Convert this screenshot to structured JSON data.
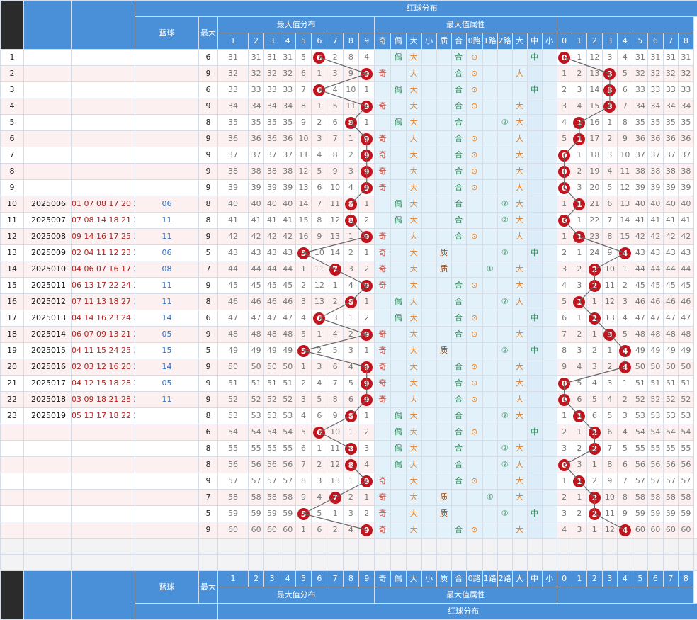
{
  "title": "红球分布",
  "groups": {
    "max_dist": "最大值分布",
    "max_attr": "最大值属性"
  },
  "headers": {
    "blue": "蓝球",
    "sum": "最大",
    "digits": [
      "1",
      "2",
      "3",
      "4",
      "5",
      "6",
      "7",
      "8",
      "9"
    ],
    "attrs": [
      "奇",
      "偶",
      "大",
      "小",
      "质",
      "合",
      "0路",
      "1路",
      "2路",
      "大",
      "中",
      "小"
    ],
    "miss_cols": [
      "0",
      "1",
      "2",
      "3",
      "4",
      "5",
      "6",
      "7",
      "8"
    ]
  },
  "rows": [
    {
      "n": "1",
      "issue": "",
      "reds": "",
      "blue": "",
      "max": "6",
      "miss": [
        "31",
        "31",
        "31",
        "31",
        "5",
        "",
        "2",
        "8",
        "4"
      ],
      "attr": {
        "oe": "偶",
        "bs": "大",
        "pc": "合",
        "road": "0",
        "size": "中"
      },
      "dist": [
        "",
        "1",
        "12",
        "3",
        "4",
        "31",
        "31",
        "31",
        "31"
      ],
      "dpos": 0
    },
    {
      "n": "2",
      "issue": "",
      "reds": "",
      "blue": "",
      "max": "9",
      "miss": [
        "32",
        "32",
        "32",
        "32",
        "6",
        "1",
        "3",
        "9",
        ""
      ],
      "attr": {
        "oe": "奇",
        "bs": "大",
        "pc": "合",
        "road": "0",
        "size": "大"
      },
      "dist": [
        "1",
        "2",
        "13",
        "",
        "5",
        "32",
        "32",
        "32",
        "32"
      ],
      "dpos": 3
    },
    {
      "n": "3",
      "issue": "",
      "reds": "",
      "blue": "",
      "max": "6",
      "miss": [
        "33",
        "33",
        "33",
        "33",
        "7",
        "",
        "4",
        "10",
        "1"
      ],
      "attr": {
        "oe": "偶",
        "bs": "大",
        "pc": "合",
        "road": "0",
        "size": "中"
      },
      "dist": [
        "2",
        "3",
        "14",
        "",
        "6",
        "33",
        "33",
        "33",
        "33"
      ],
      "dpos": 3
    },
    {
      "n": "4",
      "issue": "",
      "reds": "",
      "blue": "",
      "max": "9",
      "miss": [
        "34",
        "34",
        "34",
        "34",
        "8",
        "1",
        "5",
        "11",
        ""
      ],
      "attr": {
        "oe": "奇",
        "bs": "大",
        "pc": "合",
        "road": "0",
        "size": "大"
      },
      "dist": [
        "3",
        "4",
        "15",
        "",
        "7",
        "34",
        "34",
        "34",
        "34"
      ],
      "dpos": 3
    },
    {
      "n": "5",
      "issue": "",
      "reds": "",
      "blue": "",
      "max": "8",
      "miss": [
        "35",
        "35",
        "35",
        "35",
        "9",
        "2",
        "6",
        "",
        "1"
      ],
      "attr": {
        "oe": "偶",
        "bs": "大",
        "pc": "合",
        "road": "2",
        "size": "大"
      },
      "dist": [
        "4",
        "",
        "16",
        "1",
        "8",
        "35",
        "35",
        "35",
        "35"
      ],
      "dpos": 1
    },
    {
      "n": "6",
      "issue": "",
      "reds": "",
      "blue": "",
      "max": "9",
      "miss": [
        "36",
        "36",
        "36",
        "36",
        "10",
        "3",
        "7",
        "1",
        ""
      ],
      "attr": {
        "oe": "奇",
        "bs": "大",
        "pc": "合",
        "road": "0",
        "size": "大"
      },
      "dist": [
        "5",
        "",
        "17",
        "2",
        "9",
        "36",
        "36",
        "36",
        "36"
      ],
      "dpos": 1
    },
    {
      "n": "7",
      "issue": "",
      "reds": "",
      "blue": "",
      "max": "9",
      "miss": [
        "37",
        "37",
        "37",
        "37",
        "11",
        "4",
        "8",
        "2",
        ""
      ],
      "attr": {
        "oe": "奇",
        "bs": "大",
        "pc": "合",
        "road": "0",
        "size": "大"
      },
      "dist": [
        "",
        "1",
        "18",
        "3",
        "10",
        "37",
        "37",
        "37",
        "37"
      ],
      "dpos": 0
    },
    {
      "n": "8",
      "issue": "",
      "reds": "",
      "blue": "",
      "max": "9",
      "miss": [
        "38",
        "38",
        "38",
        "38",
        "12",
        "5",
        "9",
        "3",
        ""
      ],
      "attr": {
        "oe": "奇",
        "bs": "大",
        "pc": "合",
        "road": "0",
        "size": "大"
      },
      "dist": [
        "",
        "2",
        "19",
        "4",
        "11",
        "38",
        "38",
        "38",
        "38"
      ],
      "dpos": 0
    },
    {
      "n": "9",
      "issue": "",
      "reds": "",
      "blue": "",
      "max": "9",
      "miss": [
        "39",
        "39",
        "39",
        "39",
        "13",
        "6",
        "10",
        "4",
        ""
      ],
      "attr": {
        "oe": "奇",
        "bs": "大",
        "pc": "合",
        "road": "0",
        "size": "大"
      },
      "dist": [
        "",
        "3",
        "20",
        "5",
        "12",
        "39",
        "39",
        "39",
        "39"
      ],
      "dpos": 0
    },
    {
      "n": "10",
      "issue": "2025006",
      "reds": "01 07 08 17 20 22",
      "blue": "06",
      "max": "8",
      "miss": [
        "40",
        "40",
        "40",
        "40",
        "14",
        "7",
        "11",
        "",
        "1"
      ],
      "attr": {
        "oe": "偶",
        "bs": "大",
        "pc": "合",
        "road": "2",
        "size": "大"
      },
      "dist": [
        "1",
        "",
        "21",
        "6",
        "13",
        "40",
        "40",
        "40",
        "40"
      ],
      "dpos": 1
    },
    {
      "n": "11",
      "issue": "2025007",
      "reds": "07 08 14 18 21 27",
      "blue": "11",
      "max": "8",
      "miss": [
        "41",
        "41",
        "41",
        "41",
        "15",
        "8",
        "12",
        "",
        "2"
      ],
      "attr": {
        "oe": "偶",
        "bs": "大",
        "pc": "合",
        "road": "2",
        "size": "大"
      },
      "dist": [
        "",
        "1",
        "22",
        "7",
        "14",
        "41",
        "41",
        "41",
        "41"
      ],
      "dpos": 0
    },
    {
      "n": "12",
      "issue": "2025008",
      "reds": "09 14 16 17 25 33",
      "blue": "11",
      "max": "9",
      "miss": [
        "42",
        "42",
        "42",
        "42",
        "16",
        "9",
        "13",
        "1",
        ""
      ],
      "attr": {
        "oe": "奇",
        "bs": "大",
        "pc": "合",
        "road": "0",
        "size": "大"
      },
      "dist": [
        "1",
        "",
        "23",
        "8",
        "15",
        "42",
        "42",
        "42",
        "42"
      ],
      "dpos": 1
    },
    {
      "n": "13",
      "issue": "2025009",
      "reds": "02 04 11 12 23 25",
      "blue": "06",
      "max": "5",
      "miss": [
        "43",
        "43",
        "43",
        "43",
        "",
        "10",
        "14",
        "2",
        "1"
      ],
      "attr": {
        "oe": "奇",
        "bs": "大",
        "pc": "质",
        "road": "2",
        "size": "中"
      },
      "dist": [
        "2",
        "1",
        "24",
        "9",
        "",
        "43",
        "43",
        "43",
        "43"
      ],
      "dpos": 4
    },
    {
      "n": "14",
      "issue": "2025010",
      "reds": "04 06 07 16 17 21",
      "blue": "08",
      "max": "7",
      "miss": [
        "44",
        "44",
        "44",
        "44",
        "1",
        "11",
        "",
        "3",
        "2"
      ],
      "attr": {
        "oe": "奇",
        "bs": "大",
        "pc": "质",
        "road": "1",
        "size": "大"
      },
      "dist": [
        "3",
        "2",
        "",
        "10",
        "1",
        "44",
        "44",
        "44",
        "44"
      ],
      "dpos": 2
    },
    {
      "n": "15",
      "issue": "2025011",
      "reds": "06 13 17 22 24 29",
      "blue": "11",
      "max": "9",
      "miss": [
        "45",
        "45",
        "45",
        "45",
        "2",
        "12",
        "1",
        "4",
        ""
      ],
      "attr": {
        "oe": "奇",
        "bs": "大",
        "pc": "合",
        "road": "0",
        "size": "大"
      },
      "dist": [
        "4",
        "3",
        "",
        "11",
        "2",
        "45",
        "45",
        "45",
        "45"
      ],
      "dpos": 2
    },
    {
      "n": "16",
      "issue": "2025012",
      "reds": "07 11 13 18 27 31",
      "blue": "11",
      "max": "8",
      "miss": [
        "46",
        "46",
        "46",
        "46",
        "3",
        "13",
        "2",
        "",
        "1"
      ],
      "attr": {
        "oe": "偶",
        "bs": "大",
        "pc": "合",
        "road": "2",
        "size": "大"
      },
      "dist": [
        "5",
        "",
        "1",
        "12",
        "3",
        "46",
        "46",
        "46",
        "46"
      ],
      "dpos": 1
    },
    {
      "n": "17",
      "issue": "2025013",
      "reds": "04 14 16 23 24 30",
      "blue": "14",
      "max": "6",
      "miss": [
        "47",
        "47",
        "47",
        "47",
        "4",
        "",
        "3",
        "1",
        "2"
      ],
      "attr": {
        "oe": "偶",
        "bs": "大",
        "pc": "合",
        "road": "0",
        "size": "中"
      },
      "dist": [
        "6",
        "1",
        "",
        "13",
        "4",
        "47",
        "47",
        "47",
        "47"
      ],
      "dpos": 2
    },
    {
      "n": "18",
      "issue": "2025014",
      "reds": "06 07 09 13 21 27",
      "blue": "05",
      "max": "9",
      "miss": [
        "48",
        "48",
        "48",
        "48",
        "5",
        "1",
        "4",
        "2",
        ""
      ],
      "attr": {
        "oe": "奇",
        "bs": "大",
        "pc": "合",
        "road": "0",
        "size": "大"
      },
      "dist": [
        "7",
        "2",
        "1",
        "",
        "5",
        "48",
        "48",
        "48",
        "48"
      ],
      "dpos": 3
    },
    {
      "n": "19",
      "issue": "2025015",
      "reds": "04 11 15 24 25 33",
      "blue": "15",
      "max": "5",
      "miss": [
        "49",
        "49",
        "49",
        "49",
        "",
        "2",
        "5",
        "3",
        "1"
      ],
      "attr": {
        "oe": "奇",
        "bs": "大",
        "pc": "质",
        "road": "2",
        "size": "中"
      },
      "dist": [
        "8",
        "3",
        "2",
        "1",
        "",
        "49",
        "49",
        "49",
        "49"
      ],
      "dpos": 4
    },
    {
      "n": "20",
      "issue": "2025016",
      "reds": "02 03 12 16 20 29",
      "blue": "14",
      "max": "9",
      "miss": [
        "50",
        "50",
        "50",
        "50",
        "1",
        "3",
        "6",
        "4",
        ""
      ],
      "attr": {
        "oe": "奇",
        "bs": "大",
        "pc": "合",
        "road": "0",
        "size": "大"
      },
      "dist": [
        "9",
        "4",
        "3",
        "2",
        "",
        "50",
        "50",
        "50",
        "50"
      ],
      "dpos": 4
    },
    {
      "n": "21",
      "issue": "2025017",
      "reds": "04 12 15 18 28 29",
      "blue": "05",
      "max": "9",
      "miss": [
        "51",
        "51",
        "51",
        "51",
        "2",
        "4",
        "7",
        "5",
        ""
      ],
      "attr": {
        "oe": "奇",
        "bs": "大",
        "pc": "合",
        "road": "0",
        "size": "大"
      },
      "dist": [
        "",
        "5",
        "4",
        "3",
        "1",
        "51",
        "51",
        "51",
        "51"
      ],
      "dpos": 0
    },
    {
      "n": "22",
      "issue": "2025018",
      "reds": "03 09 18 21 28 29",
      "blue": "11",
      "max": "9",
      "miss": [
        "52",
        "52",
        "52",
        "52",
        "3",
        "5",
        "8",
        "6",
        ""
      ],
      "attr": {
        "oe": "奇",
        "bs": "大",
        "pc": "合",
        "road": "0",
        "size": "大"
      },
      "dist": [
        "",
        "6",
        "5",
        "4",
        "2",
        "52",
        "52",
        "52",
        "52"
      ],
      "dpos": 0
    },
    {
      "n": "23",
      "issue": "2025019",
      "reds": "05 13 17 18 22 23",
      "blue": "",
      "max": "8",
      "miss": [
        "53",
        "53",
        "53",
        "53",
        "4",
        "6",
        "9",
        "",
        "1"
      ],
      "attr": {
        "oe": "偶",
        "bs": "大",
        "pc": "合",
        "road": "2",
        "size": "大"
      },
      "dist": [
        "1",
        "",
        "6",
        "5",
        "3",
        "53",
        "53",
        "53",
        "53"
      ],
      "dpos": 1
    },
    {
      "n": "",
      "issue": "",
      "reds": "",
      "blue": "",
      "max": "6",
      "miss": [
        "54",
        "54",
        "54",
        "54",
        "5",
        "",
        "10",
        "1",
        "2"
      ],
      "attr": {
        "oe": "偶",
        "bs": "大",
        "pc": "合",
        "road": "0",
        "size": "中"
      },
      "dist": [
        "2",
        "1",
        "",
        "6",
        "4",
        "54",
        "54",
        "54",
        "54"
      ],
      "dpos": 2
    },
    {
      "n": "",
      "issue": "",
      "reds": "",
      "blue": "",
      "max": "8",
      "miss": [
        "55",
        "55",
        "55",
        "55",
        "6",
        "1",
        "11",
        "",
        "3"
      ],
      "attr": {
        "oe": "偶",
        "bs": "大",
        "pc": "合",
        "road": "2",
        "size": "大"
      },
      "dist": [
        "3",
        "2",
        "",
        "7",
        "5",
        "55",
        "55",
        "55",
        "55"
      ],
      "dpos": 2
    },
    {
      "n": "",
      "issue": "",
      "reds": "",
      "blue": "",
      "max": "8",
      "miss": [
        "56",
        "56",
        "56",
        "56",
        "7",
        "2",
        "12",
        "",
        "4"
      ],
      "attr": {
        "oe": "偶",
        "bs": "大",
        "pc": "合",
        "road": "2",
        "size": "大"
      },
      "dist": [
        "",
        "3",
        "1",
        "8",
        "6",
        "56",
        "56",
        "56",
        "56"
      ],
      "dpos": 0
    },
    {
      "n": "",
      "issue": "",
      "reds": "",
      "blue": "",
      "max": "9",
      "miss": [
        "57",
        "57",
        "57",
        "57",
        "8",
        "3",
        "13",
        "1",
        ""
      ],
      "attr": {
        "oe": "奇",
        "bs": "大",
        "pc": "合",
        "road": "0",
        "size": "大"
      },
      "dist": [
        "1",
        "",
        "2",
        "9",
        "7",
        "57",
        "57",
        "57",
        "57"
      ],
      "dpos": 1
    },
    {
      "n": "",
      "issue": "",
      "reds": "",
      "blue": "",
      "max": "7",
      "miss": [
        "58",
        "58",
        "58",
        "58",
        "9",
        "4",
        "",
        "2",
        "1"
      ],
      "attr": {
        "oe": "奇",
        "bs": "大",
        "pc": "质",
        "road": "1",
        "size": "大"
      },
      "dist": [
        "2",
        "1",
        "",
        "10",
        "8",
        "58",
        "58",
        "58",
        "58"
      ],
      "dpos": 2
    },
    {
      "n": "",
      "issue": "",
      "reds": "",
      "blue": "",
      "max": "5",
      "miss": [
        "59",
        "59",
        "59",
        "59",
        "",
        "5",
        "1",
        "3",
        "2"
      ],
      "attr": {
        "oe": "奇",
        "bs": "大",
        "pc": "质",
        "road": "2",
        "size": "中"
      },
      "dist": [
        "3",
        "2",
        "",
        "11",
        "9",
        "59",
        "59",
        "59",
        "59"
      ],
      "dpos": 2
    },
    {
      "n": "",
      "issue": "",
      "reds": "",
      "blue": "",
      "max": "9",
      "miss": [
        "60",
        "60",
        "60",
        "60",
        "1",
        "6",
        "2",
        "4",
        ""
      ],
      "attr": {
        "oe": "奇",
        "bs": "大",
        "pc": "合",
        "road": "0",
        "size": "大"
      },
      "dist": [
        "4",
        "3",
        "1",
        "12",
        "",
        "60",
        "60",
        "60",
        "60"
      ],
      "dpos": 4
    }
  ],
  "chart_data": {
    "type": "table",
    "title": "红球分布",
    "max_values": [
      6,
      9,
      6,
      9,
      8,
      9,
      9,
      9,
      9,
      8,
      8,
      9,
      5,
      7,
      9,
      8,
      6,
      9,
      5,
      9,
      9,
      9,
      8,
      6,
      8,
      8,
      9,
      7,
      5,
      9
    ]
  }
}
